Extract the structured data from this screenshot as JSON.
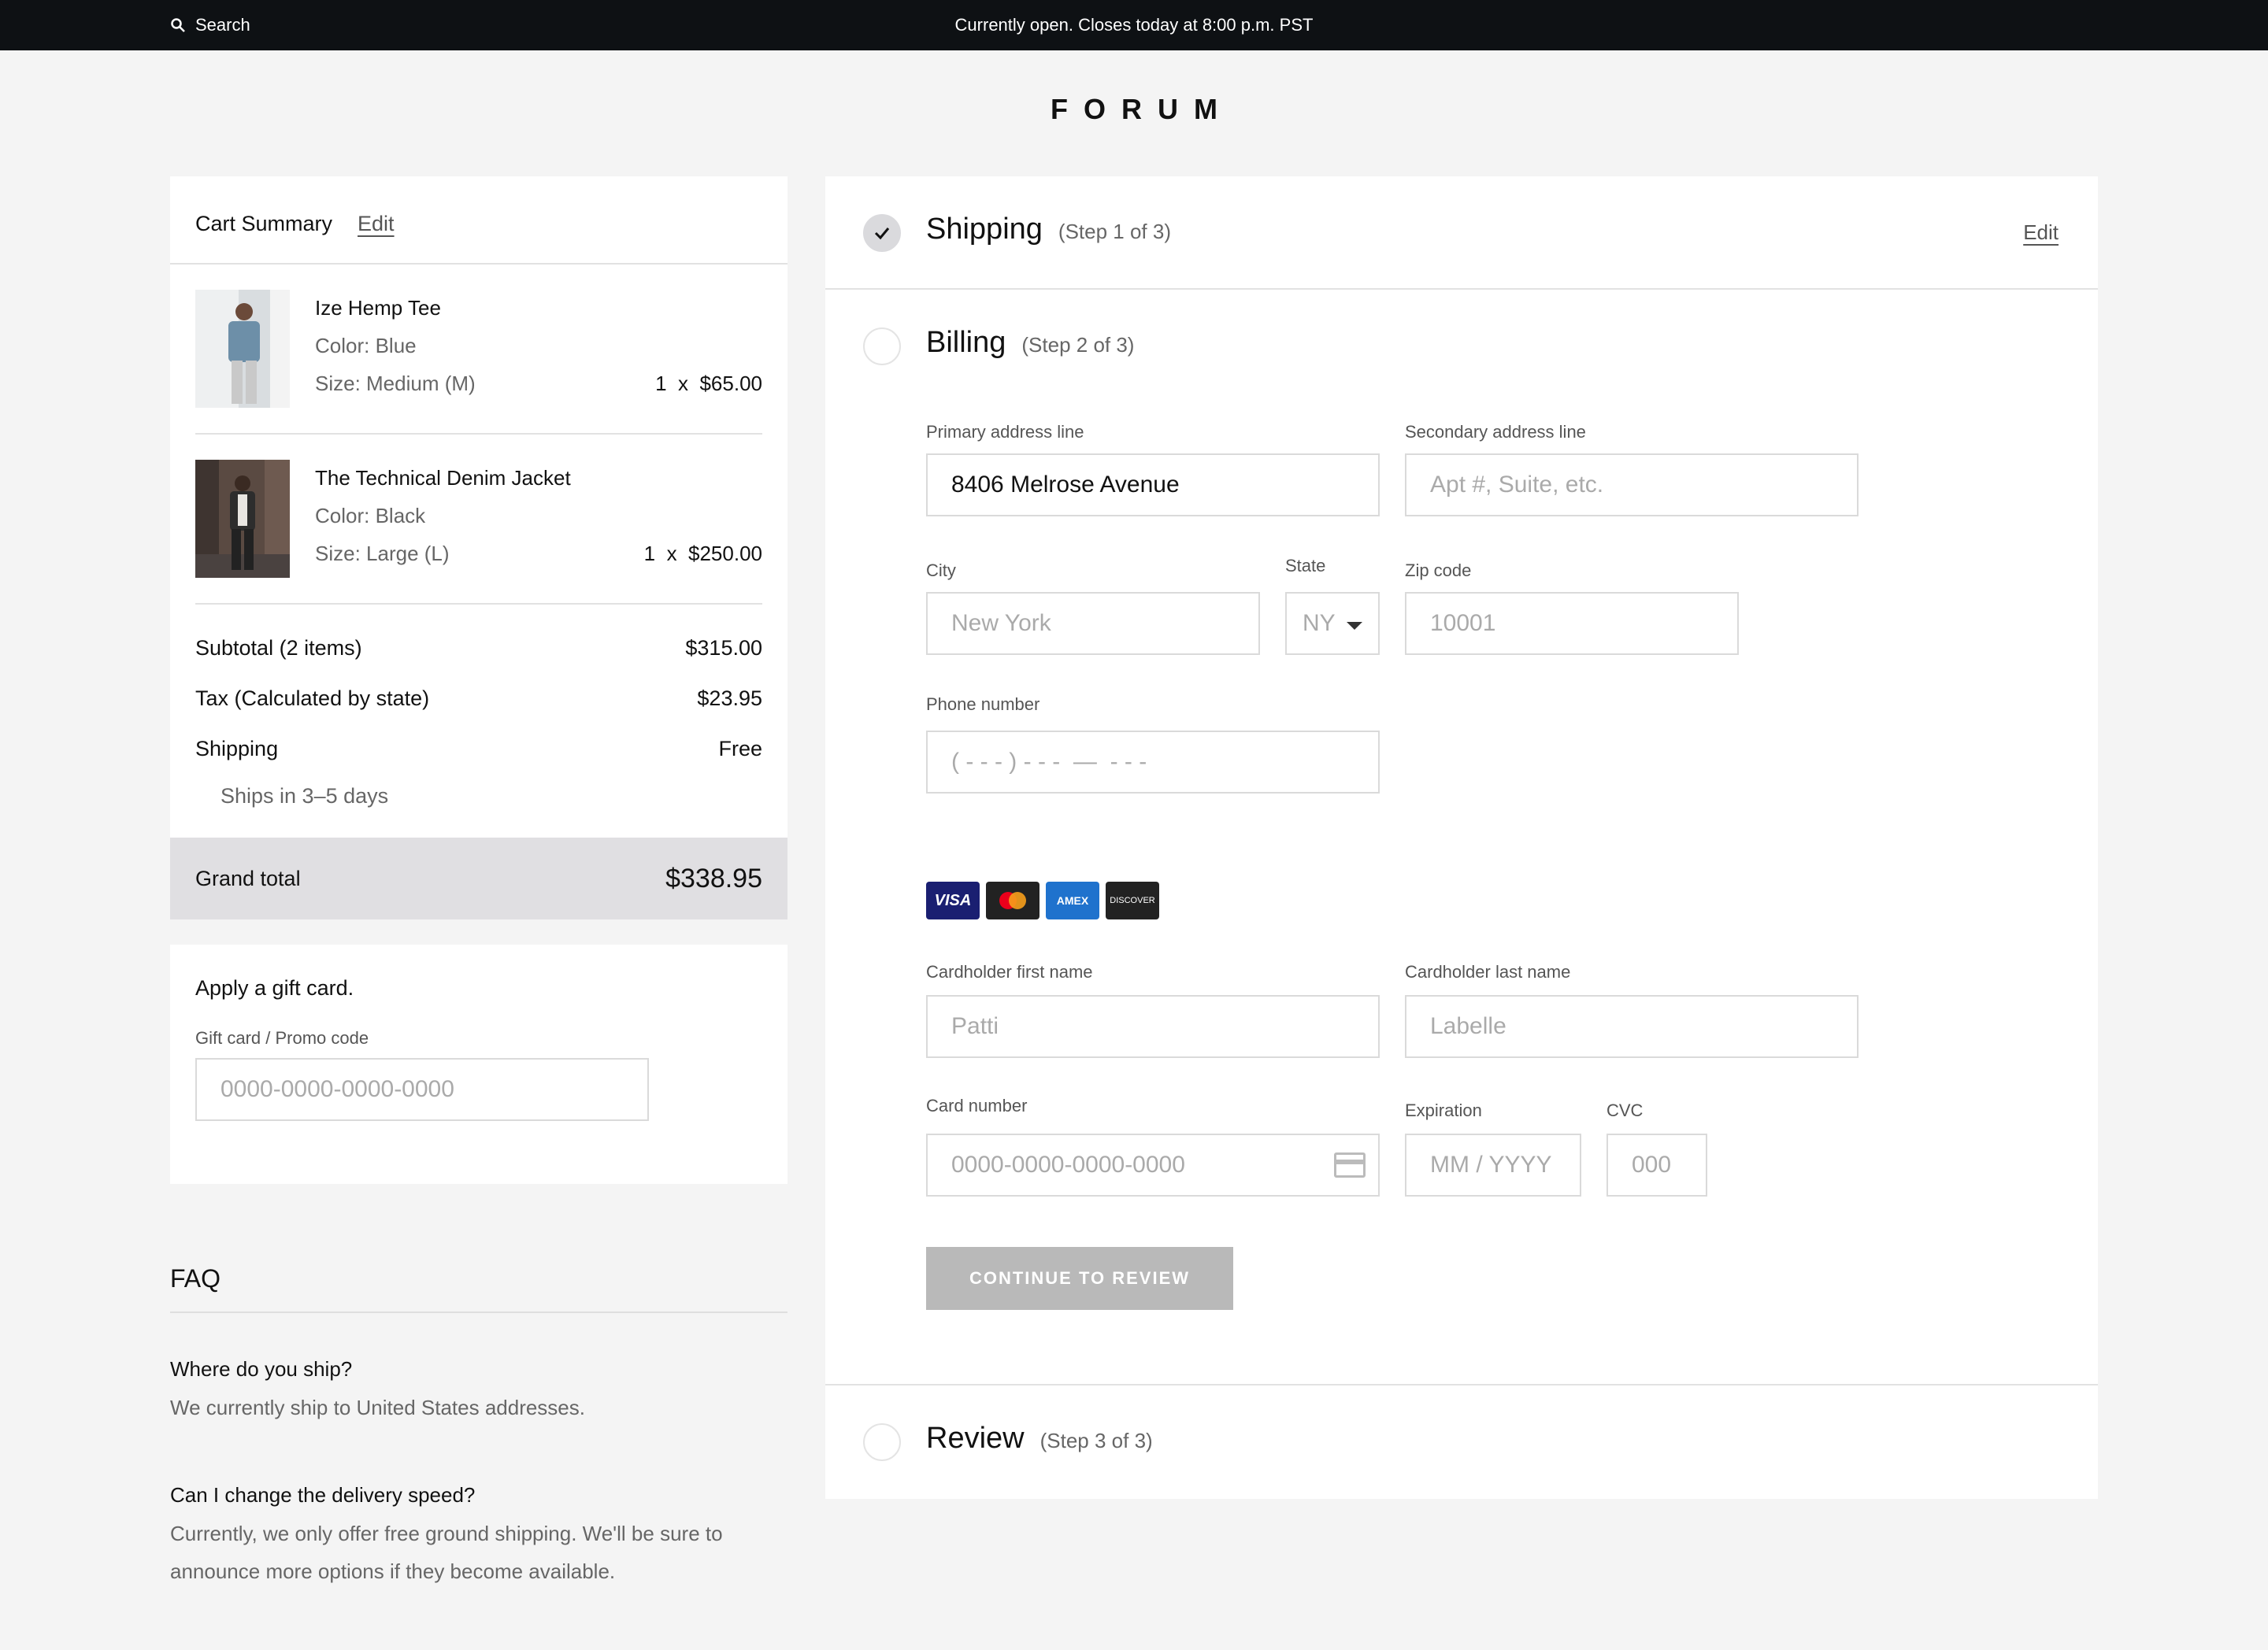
{
  "topbar": {
    "search_label": "Search",
    "status": "Currently open. Closes today at 8:00 p.m. PST"
  },
  "brand": {
    "logo": "FORUM"
  },
  "cart": {
    "title": "Cart Summary",
    "edit_label": "Edit",
    "items": [
      {
        "name": "Ize Hemp Tee",
        "color": "Color: Blue",
        "size": "Size: Medium (M)",
        "qty_price": "1  x  $65.00"
      },
      {
        "name": "The Technical Denim Jacket",
        "color": "Color: Black",
        "size": "Size: Large (L)",
        "qty_price": "1  x  $250.00"
      }
    ],
    "subtotal": {
      "label": "Subtotal (2 items)",
      "value": "$315.00"
    },
    "tax": {
      "label": "Tax (Calculated by state)",
      "value": "$23.95"
    },
    "shipping": {
      "label": "Shipping",
      "value": "Free",
      "note": "Ships in 3–5 days"
    },
    "grand_total": {
      "label": "Grand total",
      "value": "$338.95"
    }
  },
  "gift": {
    "title": "Apply a gift card.",
    "field_label": "Gift card / Promo code",
    "placeholder": "0000-0000-0000-0000"
  },
  "faq": {
    "title": "FAQ",
    "items": [
      {
        "q": "Where do you ship?",
        "a": "We currently ship to United States addresses."
      },
      {
        "q": "Can I change the delivery speed?",
        "a": "Currently, we only offer free ground shipping. We'll be sure to announce more options if they become available."
      }
    ]
  },
  "steps": {
    "shipping": {
      "title": "Shipping",
      "step": "(Step 1 of 3)",
      "edit_label": "Edit",
      "completed": true
    },
    "billing": {
      "title": "Billing",
      "step": "(Step 2 of 3)"
    },
    "review": {
      "title": "Review",
      "step": "(Step 3 of 3)"
    }
  },
  "billing_form": {
    "primary_address": {
      "label": "Primary address line",
      "value": "8406 Melrose Avenue"
    },
    "secondary_address": {
      "label": "Secondary address line",
      "placeholder": "Apt #, Suite, etc."
    },
    "city": {
      "label": "City",
      "placeholder": "New York"
    },
    "state": {
      "label": "State",
      "value": "NY"
    },
    "zip": {
      "label": "Zip code",
      "placeholder": "10001"
    },
    "phone": {
      "label": "Phone number",
      "placeholder": "( - - - ) - - -  —  - - -"
    },
    "payment_methods": [
      "VISA",
      "Mastercard",
      "AMEX",
      "DISCOVER"
    ],
    "first_name": {
      "label": "Cardholder first name",
      "placeholder": "Patti"
    },
    "last_name": {
      "label": "Cardholder last name",
      "placeholder": "Labelle"
    },
    "card_number": {
      "label": "Card number",
      "placeholder": "0000-0000-0000-0000"
    },
    "expiration": {
      "label": "Expiration",
      "placeholder": "MM / YYYY"
    },
    "cvc": {
      "label": "CVC",
      "placeholder": "000"
    },
    "continue_label": "CONTINUE TO REVIEW"
  },
  "colors": {
    "topbar_bg": "#0e1114",
    "grand_total_bg": "#e0dfe2",
    "button_disabled": "#b9b9b9",
    "visa": "#1a1f71",
    "amex": "#1f72cd"
  }
}
